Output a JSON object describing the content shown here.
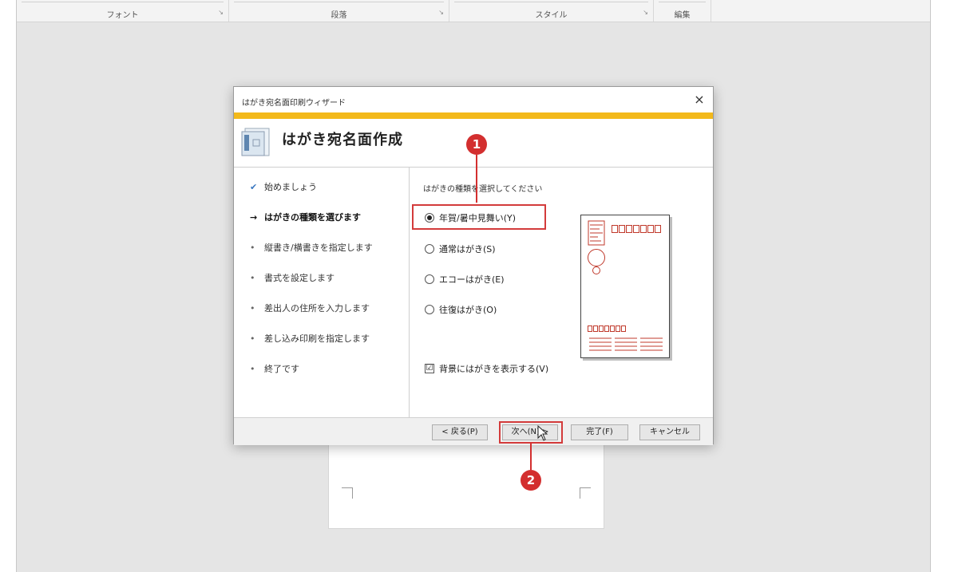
{
  "ribbon": {
    "groups": [
      "フォント",
      "段落",
      "スタイル",
      "編集"
    ]
  },
  "dialog": {
    "title": "はがき宛名面印刷ウィザード",
    "close": "×",
    "header": "はがき宛名面作成",
    "steps": [
      {
        "label": "始めましょう",
        "state": "done",
        "mark": "✔"
      },
      {
        "label": "はがきの種類を選びます",
        "state": "current",
        "mark": "→"
      },
      {
        "label": "縦書き/横書きを指定します",
        "state": "pending",
        "mark": "•"
      },
      {
        "label": "書式を設定します",
        "state": "pending",
        "mark": "•"
      },
      {
        "label": "差出人の住所を入力します",
        "state": "pending",
        "mark": "•"
      },
      {
        "label": "差し込み印刷を指定します",
        "state": "pending",
        "mark": "•"
      },
      {
        "label": "終了です",
        "state": "pending",
        "mark": "•"
      }
    ],
    "prompt": "はがきの種類を選択してください",
    "options": [
      {
        "label": "年賀/暑中見舞い(Y)",
        "selected": true
      },
      {
        "label": "通常はがき(S)",
        "selected": false
      },
      {
        "label": "エコーはがき(E)",
        "selected": false
      },
      {
        "label": "往復はがき(O)",
        "selected": false
      }
    ],
    "background_checkbox": {
      "label": "背景にはがきを表示する(V)",
      "checked": true,
      "mark": "☑"
    },
    "buttons": {
      "back": "< 戻る(P)",
      "next": "次へ(N) >",
      "finish": "完了(F)",
      "cancel": "キャンセル"
    }
  },
  "callouts": [
    "1",
    "2"
  ],
  "colors": {
    "accent": "#f3b91a",
    "highlight": "#d33b3b",
    "callout": "#d32f2f"
  }
}
